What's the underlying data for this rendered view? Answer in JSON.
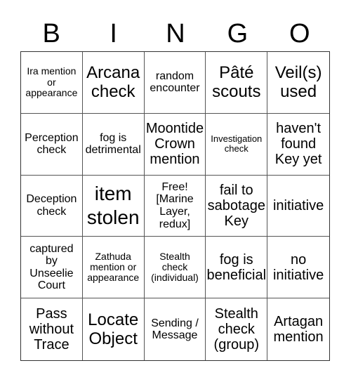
{
  "header": [
    "B",
    "I",
    "N",
    "G",
    "O"
  ],
  "cells": [
    {
      "text": "Ira mention or appearance",
      "size": "s-sm"
    },
    {
      "text": "Arcana check",
      "size": "s-xl"
    },
    {
      "text": "random encounter",
      "size": "s-md"
    },
    {
      "text": "Pâté scouts",
      "size": "s-xl"
    },
    {
      "text": "Veil(s) used",
      "size": "s-xl"
    },
    {
      "text": "Perception check",
      "size": "s-md"
    },
    {
      "text": "fog is detrimental",
      "size": "s-md"
    },
    {
      "text": "Moontide Crown mention",
      "size": "s-lg"
    },
    {
      "text": "Investigation check",
      "size": "s-xs"
    },
    {
      "text": "haven't found Key yet",
      "size": "s-lg"
    },
    {
      "text": "Deception check",
      "size": "s-md"
    },
    {
      "text": "item stolen",
      "size": "s-xxl"
    },
    {
      "text": "Free! [Marine Layer, redux]",
      "size": "s-md"
    },
    {
      "text": "fail to sabotage Key",
      "size": "s-lg"
    },
    {
      "text": "initiative",
      "size": "s-lg"
    },
    {
      "text": "captured by Unseelie Court",
      "size": "s-md"
    },
    {
      "text": "Zathuda mention or appearance",
      "size": "s-sm"
    },
    {
      "text": "Stealth check (individual)",
      "size": "s-sm"
    },
    {
      "text": "fog is beneficial",
      "size": "s-lg"
    },
    {
      "text": "no initiative",
      "size": "s-lg"
    },
    {
      "text": "Pass without Trace",
      "size": "s-lg"
    },
    {
      "text": "Locate Object",
      "size": "s-xl"
    },
    {
      "text": "Sending / Message",
      "size": "s-md"
    },
    {
      "text": "Stealth check (group)",
      "size": "s-lg"
    },
    {
      "text": "Artagan mention",
      "size": "s-lg"
    }
  ]
}
